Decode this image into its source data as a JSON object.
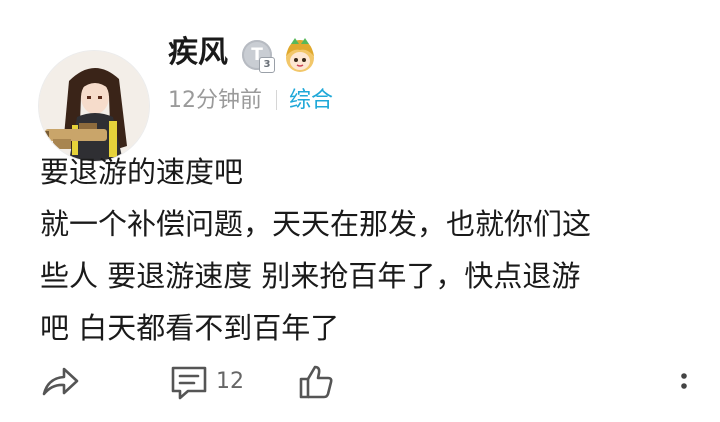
{
  "post": {
    "username": "疾风",
    "level_badge": {
      "letter": "T",
      "number": "3"
    },
    "time": "12分钟前",
    "category": "综合",
    "body_lines": [
      "要退游的速度吧",
      "就一个补偿问题，天天在那发，也就你们这",
      "些人 要退游速度 别来抢百年了，快点退游",
      "吧 白天都看不到百年了"
    ]
  },
  "actions": {
    "comment_count": "12"
  },
  "colors": {
    "accent": "#1fa8d8",
    "muted": "#9a9a9a",
    "icon": "#666666"
  }
}
